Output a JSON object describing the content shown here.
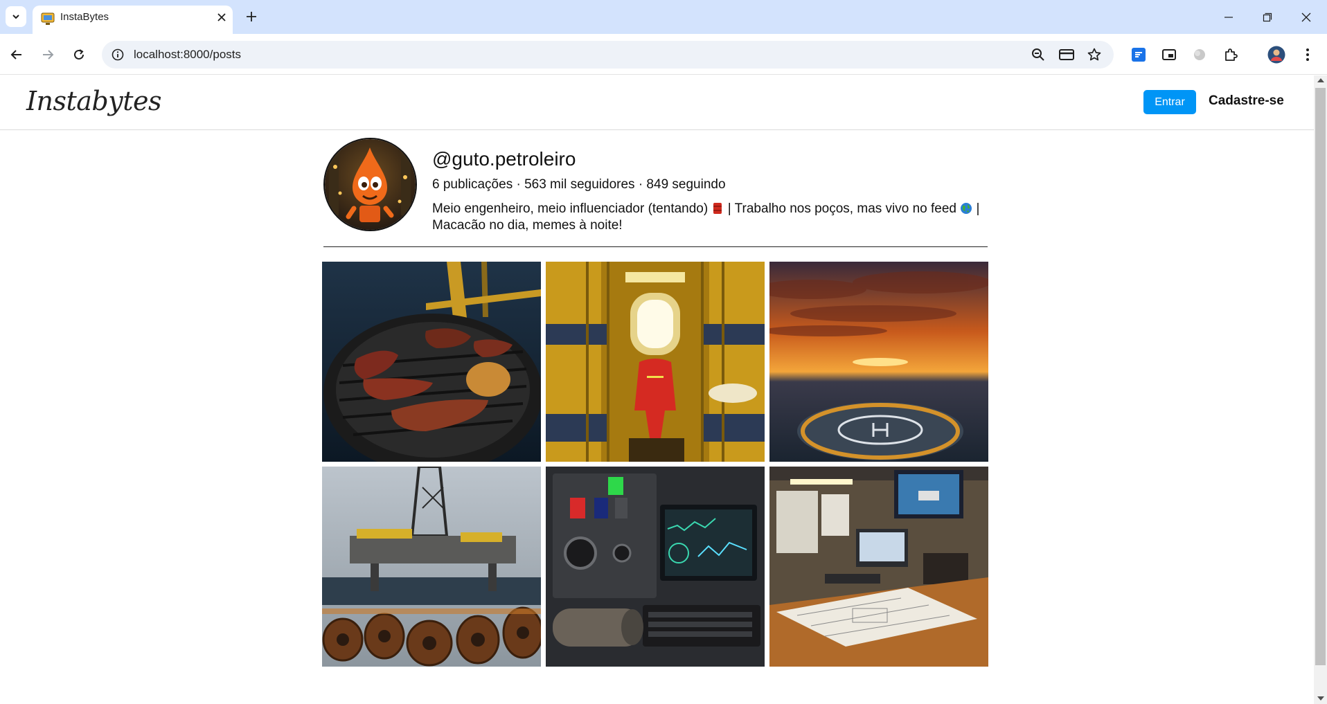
{
  "browser": {
    "tab_title": "InstaBytes",
    "url": "localhost:8000/posts"
  },
  "header": {
    "logo": "Instabytes",
    "login_label": "Entrar",
    "signup_label": "Cadastre-se"
  },
  "profile": {
    "username": "@guto.petroleiro",
    "stats": "6 publicações · 563 mil seguidores · 849 seguindo",
    "bio_part1": "Meio engenheiro, meio influenciador (tentando) ",
    "bio_part2": " | Trabalho nos poços, mas vivo no feed ",
    "bio_part3": " | Macacão no dia, memes à noite!",
    "emoji_1": "oil-barrel-emoji",
    "emoji_2": "globe-emoji"
  },
  "posts": [
    {
      "subject": "barbecue-grill-on-platform"
    },
    {
      "subject": "bunk-room-with-red-coverall"
    },
    {
      "subject": "sunset-over-helipad"
    },
    {
      "subject": "offshore-rig-with-drill-pipes"
    },
    {
      "subject": "control-panel-with-core-sample"
    },
    {
      "subject": "engineering-desk-with-blueprints"
    }
  ],
  "colors": {
    "tabstrip": "#d3e3fd",
    "primary_button": "#0095f6",
    "text": "#111111"
  }
}
